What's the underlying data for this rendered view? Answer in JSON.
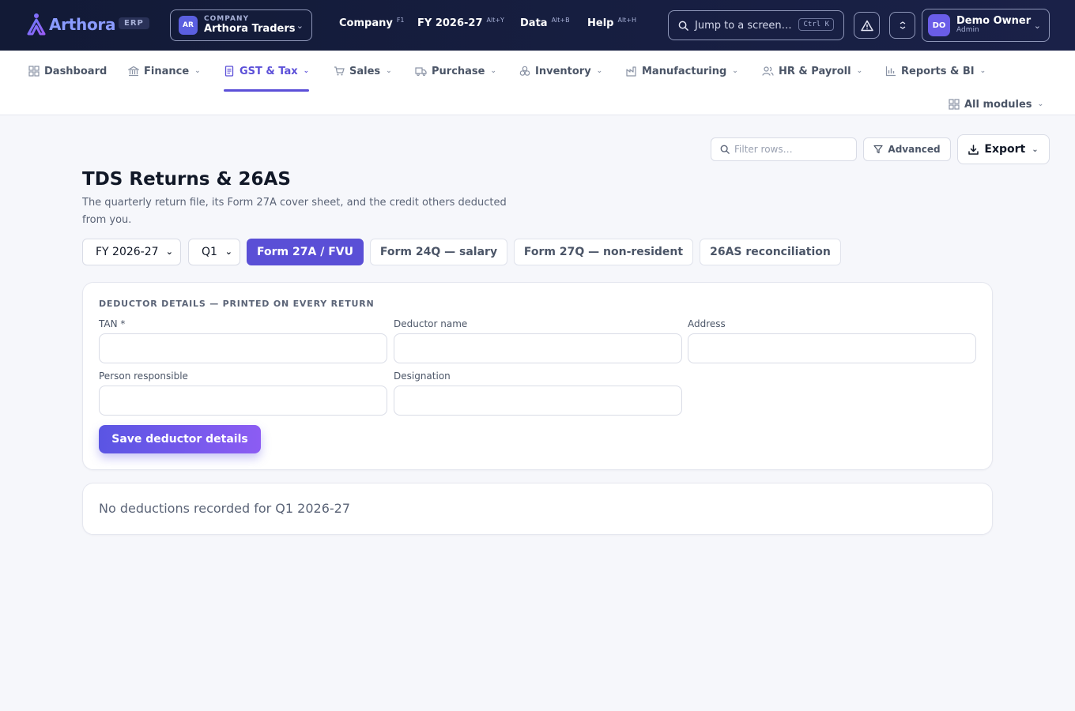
{
  "app": {
    "brand": "Arthora",
    "badge": "ERP"
  },
  "company": {
    "caption": "COMPANY",
    "initials": "AR",
    "name": "Arthora Traders"
  },
  "topmenu": [
    {
      "label": "Company",
      "shortcut": "F1"
    },
    {
      "label": "FY 2026-27",
      "shortcut": "Alt+Y"
    },
    {
      "label": "Data",
      "shortcut": "Alt+B"
    },
    {
      "label": "Help",
      "shortcut": "Alt+H"
    }
  ],
  "search": {
    "placeholder": "Jump to a screen…",
    "shortcut": "Ctrl K"
  },
  "user": {
    "initials": "DO",
    "name": "Demo Owner",
    "role": "Admin"
  },
  "modules": [
    {
      "label": "Dashboard",
      "icon": "grid-icon"
    },
    {
      "label": "Finance",
      "icon": "bank-icon"
    },
    {
      "label": "GST & Tax",
      "icon": "document-icon",
      "active": true
    },
    {
      "label": "Sales",
      "icon": "cart-icon"
    },
    {
      "label": "Purchase",
      "icon": "truck-icon"
    },
    {
      "label": "Inventory",
      "icon": "boxes-icon"
    },
    {
      "label": "Manufacturing",
      "icon": "factory-icon"
    },
    {
      "label": "HR & Payroll",
      "icon": "users-icon"
    },
    {
      "label": "Reports & BI",
      "icon": "bar-chart-icon"
    },
    {
      "label": "All modules",
      "icon": "grid-icon"
    }
  ],
  "toolbar": {
    "filter_placeholder": "Filter rows…",
    "advanced_label": "Advanced",
    "export_label": "Export"
  },
  "page": {
    "title": "TDS Returns & 26AS",
    "description": "The quarterly return file, its Form 27A cover sheet, and the credit others deducted from you."
  },
  "controls": {
    "fy_value": "FY 2026-27",
    "quarter_value": "Q1",
    "tabs": [
      "Form 27A / FVU",
      "Form 24Q — salary",
      "Form 27Q — non-resident",
      "26AS reconciliation"
    ],
    "active_tab": "Form 27A / FVU"
  },
  "deductor": {
    "heading": "DEDUCTOR DETAILS — PRINTED ON EVERY RETURN",
    "fields": {
      "tan": {
        "label": "TAN *",
        "value": ""
      },
      "name": {
        "label": "Deductor name",
        "value": ""
      },
      "address": {
        "label": "Address",
        "value": ""
      },
      "person": {
        "label": "Person responsible",
        "value": ""
      },
      "designation": {
        "label": "Designation",
        "value": ""
      }
    },
    "save_label": "Save deductor details"
  },
  "deductions": {
    "empty_message": "No deductions recorded for Q1 2026-27"
  },
  "colors": {
    "topbar": "#121a36",
    "accent": "#5a4fd6",
    "accent_gradient_end": "#8c5cf3",
    "page_bg": "#f6f7fb"
  }
}
